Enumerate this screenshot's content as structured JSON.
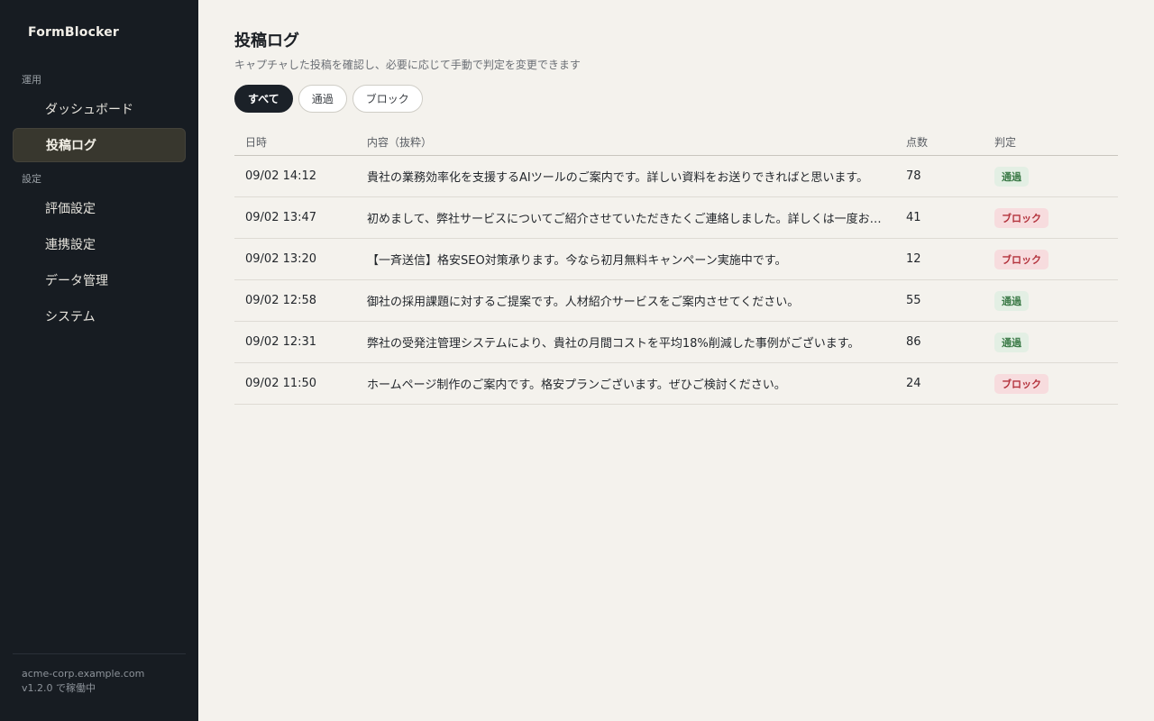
{
  "app": {
    "brand": "FormBlocker"
  },
  "sidebar": {
    "sections": [
      {
        "label": "運用",
        "items": [
          {
            "label": "ダッシュボード",
            "active": false
          },
          {
            "label": "投稿ログ",
            "active": true
          }
        ]
      },
      {
        "label": "設定",
        "items": [
          {
            "label": "評価設定",
            "active": false
          },
          {
            "label": "連携設定",
            "active": false
          },
          {
            "label": "データ管理",
            "active": false
          },
          {
            "label": "システム",
            "active": false
          }
        ]
      }
    ],
    "footer": {
      "domain": "acme-corp.example.com",
      "status": "v1.2.0 で稼働中"
    }
  },
  "main": {
    "title": "投稿ログ",
    "subtitle": "キャプチャした投稿を確認し、必要に応じて手動で判定を変更できます",
    "filters": [
      {
        "label": "すべて",
        "active": true
      },
      {
        "label": "通過",
        "active": false
      },
      {
        "label": "ブロック",
        "active": false
      }
    ],
    "table": {
      "headers": {
        "date": "日時",
        "content": "内容（抜粋）",
        "score": "点数",
        "verdict": "判定"
      },
      "rows": [
        {
          "date": "09/02 14:12",
          "content": "貴社の業務効率化を支援するAIツールのご案内です。詳しい資料をお送りできればと思います。",
          "score": "78",
          "verdict": "通過",
          "verdict_type": "pass"
        },
        {
          "date": "09/02 13:47",
          "content": "初めまして、弊社サービスについてご紹介させていただきたくご連絡しました。詳しくは一度お…",
          "score": "41",
          "verdict": "ブロック",
          "verdict_type": "block"
        },
        {
          "date": "09/02 13:20",
          "content": "【一斉送信】格安SEO対策承ります。今なら初月無料キャンペーン実施中です。",
          "score": "12",
          "verdict": "ブロック",
          "verdict_type": "block"
        },
        {
          "date": "09/02 12:58",
          "content": "御社の採用課題に対するご提案です。人材紹介サービスをご案内させてください。",
          "score": "55",
          "verdict": "通過",
          "verdict_type": "pass"
        },
        {
          "date": "09/02 12:31",
          "content": "弊社の受発注管理システムにより、貴社の月間コストを平均18%削減した事例がございます。",
          "score": "86",
          "verdict": "通過",
          "verdict_type": "pass"
        },
        {
          "date": "09/02 11:50",
          "content": "ホームページ制作のご案内です。格安プランございます。ぜひご検討ください。",
          "score": "24",
          "verdict": "ブロック",
          "verdict_type": "block"
        }
      ]
    }
  },
  "colors": {
    "sidebar_bg": "#171c22",
    "page_bg": "#f4f2ed",
    "pass": "#3b7a47",
    "block": "#b3323c"
  }
}
